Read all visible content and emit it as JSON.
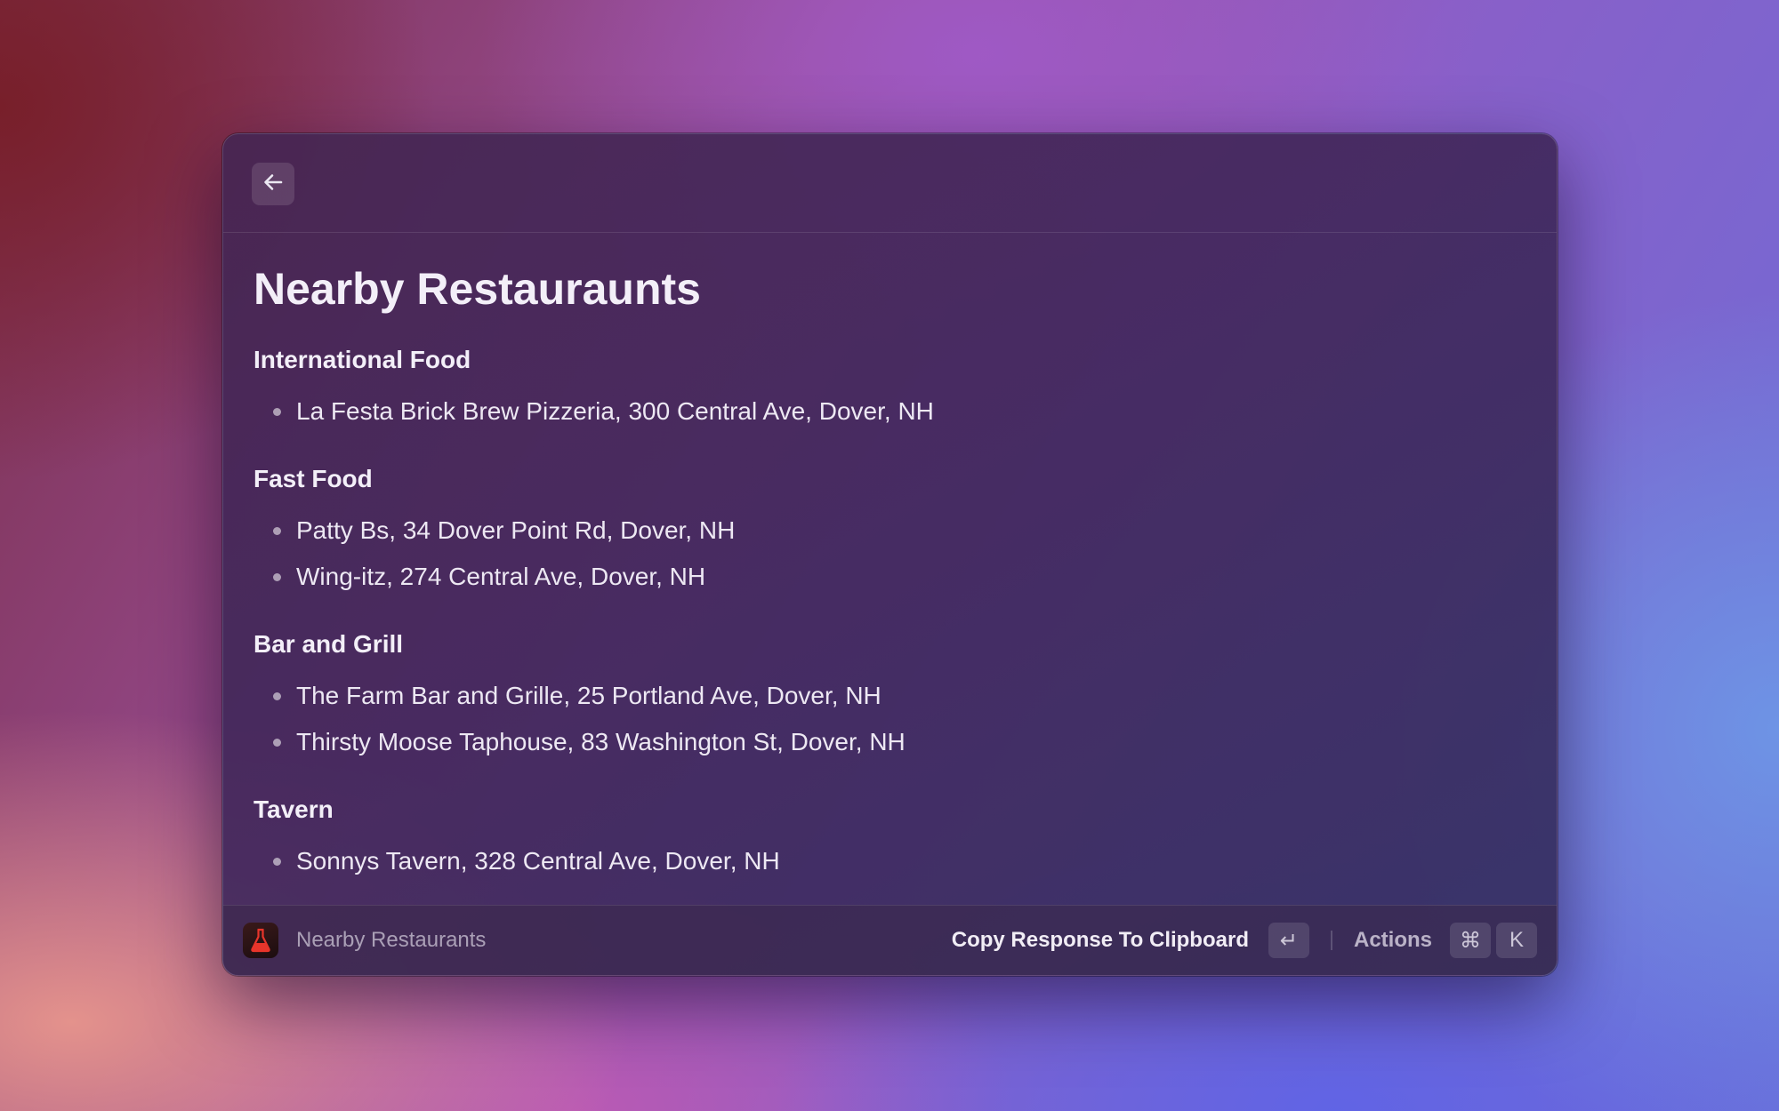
{
  "header": {
    "back_icon": "arrow-left-icon"
  },
  "main": {
    "title": "Nearby Restauraunts",
    "sections": [
      {
        "title": "International Food",
        "items": [
          "La Festa Brick  Brew Pizzeria, 300 Central Ave, Dover, NH"
        ]
      },
      {
        "title": "Fast Food",
        "items": [
          "Patty Bs, 34 Dover Point Rd, Dover, NH",
          "Wing-itz, 274 Central Ave, Dover, NH"
        ]
      },
      {
        "title": "Bar and Grill",
        "items": [
          "The Farm Bar and Grille, 25 Portland Ave, Dover, NH",
          "Thirsty Moose Taphouse, 83 Washington St, Dover, NH"
        ]
      },
      {
        "title": "Tavern",
        "items": [
          "Sonnys Tavern, 328 Central Ave, Dover, NH"
        ]
      }
    ]
  },
  "footer": {
    "icon": "flask-icon",
    "title": "Nearby Restaurants",
    "primary_action": "Copy Response To Clipboard",
    "primary_shortcut": "↵",
    "actions_label": "Actions",
    "actions_shortcut_mod": "⌘",
    "actions_shortcut_key": "K"
  },
  "colors": {
    "window_bg": "#46285a",
    "text": "#f1edf5",
    "flask_red": "#e8352b"
  }
}
